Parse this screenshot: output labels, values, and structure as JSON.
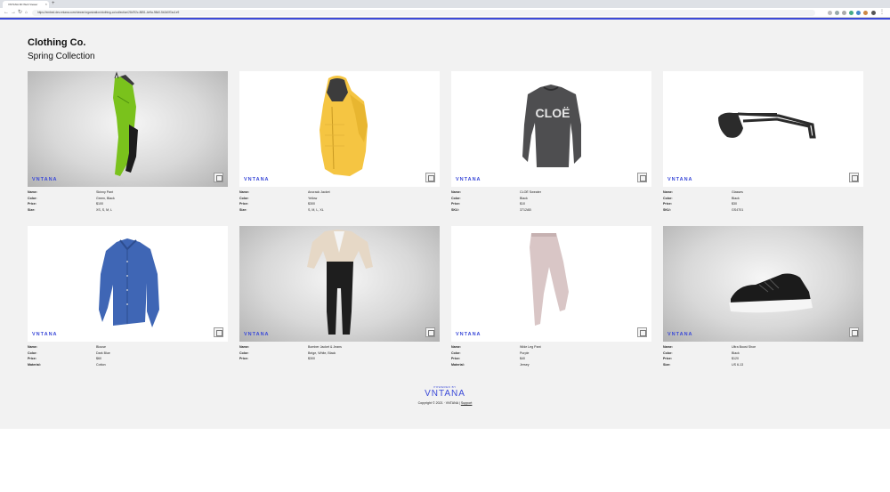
{
  "browser": {
    "tab_title": "VNTANA 3D Web Viewer",
    "url": "https://embed.dev.vntana.com/viewer/organization/clothing-co/collection/28d7f2c-8851-4e9a-98d0-5b2d0f7ac1e9"
  },
  "header": {
    "brand": "Clothing Co.",
    "collection": "Spring Collection"
  },
  "viewer": {
    "watermark": "VNTANA"
  },
  "products": [
    {
      "name": "Skinny Pant",
      "rows": [
        [
          "Name:",
          "Skinny Pant"
        ],
        [
          "Color:",
          "Green, Black"
        ],
        [
          "Price:",
          "$100"
        ],
        [
          "Size:",
          "XS, S, M, L"
        ]
      ]
    },
    {
      "name": "Anorack Jacket",
      "rows": [
        [
          "Name:",
          "Anorack Jacket"
        ],
        [
          "Color:",
          "Yellow"
        ],
        [
          "Price:",
          "$300"
        ],
        [
          "Size:",
          "S, M, L, XL"
        ]
      ]
    },
    {
      "name": "CLOË Sweater",
      "rows": [
        [
          "Name:",
          "CLOË Sweater"
        ],
        [
          "Color:",
          "Black"
        ],
        [
          "Price:",
          "$10"
        ],
        [
          "SKU:",
          "3712AB"
        ]
      ]
    },
    {
      "name": "Glasses",
      "rows": [
        [
          "Name:",
          "Glasses"
        ],
        [
          "Color:",
          "Black"
        ],
        [
          "Price:",
          "$30"
        ],
        [
          "SKU:",
          "GS4701"
        ]
      ]
    },
    {
      "name": "Blouse",
      "rows": [
        [
          "Name:",
          "Blouse"
        ],
        [
          "Color:",
          "Dark Blue"
        ],
        [
          "Price:",
          "$60"
        ],
        [
          "Material:",
          "Cotton"
        ]
      ]
    },
    {
      "name": "Bomber Jacket & Jeans",
      "rows": [
        [
          "Name:",
          "Bomber Jacket & Jeans"
        ],
        [
          "Color:",
          "Beige, White, Black"
        ],
        [
          "Price:",
          "$300"
        ]
      ]
    },
    {
      "name": "Wide Leg Pant",
      "rows": [
        [
          "Name:",
          "Wide Leg Pant"
        ],
        [
          "Color:",
          "Purple"
        ],
        [
          "Price:",
          "$40"
        ],
        [
          "Material:",
          "Jersey"
        ]
      ]
    },
    {
      "name": "Ultra Boost Shoe",
      "rows": [
        [
          "Name:",
          "Ultra Boost Shoe"
        ],
        [
          "Color:",
          "Black"
        ],
        [
          "Price:",
          "$120"
        ],
        [
          "Size:",
          "US 6-13"
        ]
      ]
    }
  ],
  "footer": {
    "powered_by": "POWERED BY",
    "logo": "VNTANA",
    "copyright": "Copyright © 2021 · VNTANA |",
    "support": "Support"
  },
  "colors": {
    "accent": "#3b4ad8",
    "page_bg": "#f2f2f2"
  }
}
